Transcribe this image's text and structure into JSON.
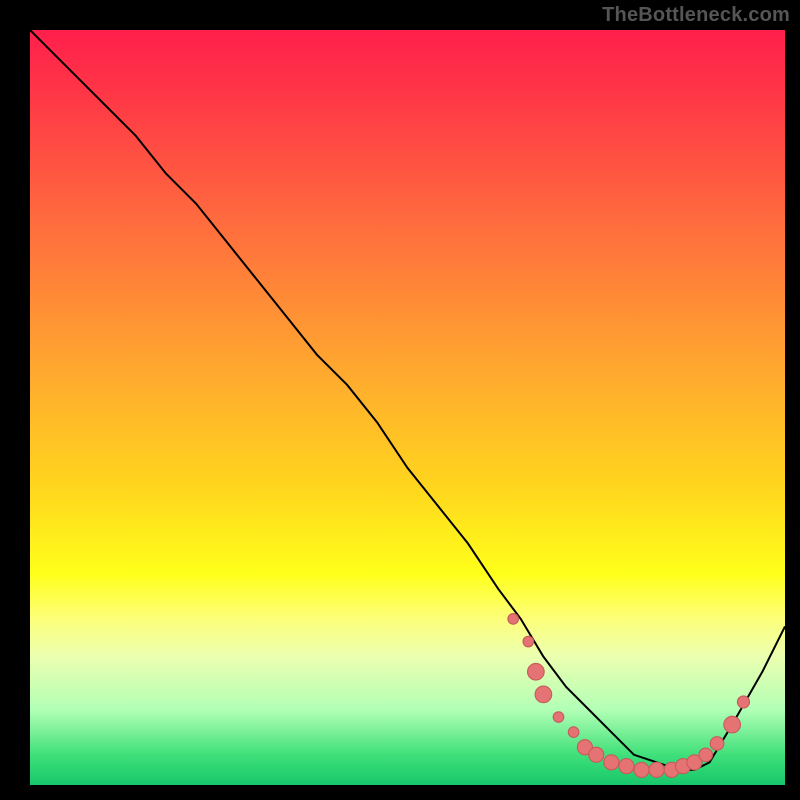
{
  "attribution": "TheBottleneck.com",
  "chart_data": {
    "type": "line",
    "title": "",
    "xlabel": "",
    "ylabel": "",
    "xlim": [
      0,
      100
    ],
    "ylim": [
      0,
      100
    ],
    "grid": false,
    "legend": false,
    "series": [
      {
        "name": "curve",
        "x": [
          0,
          3,
          6,
          10,
          14,
          18,
          22,
          26,
          30,
          34,
          38,
          42,
          46,
          50,
          54,
          58,
          62,
          65,
          68,
          71,
          74,
          77,
          80,
          83,
          86,
          88,
          90,
          93,
          97,
          100
        ],
        "values": [
          100,
          97,
          94,
          90,
          86,
          81,
          77,
          72,
          67,
          62,
          57,
          53,
          48,
          42,
          37,
          32,
          26,
          22,
          17,
          13,
          10,
          7,
          4,
          3,
          2,
          2,
          3,
          8,
          15,
          21
        ]
      }
    ],
    "markers": [
      {
        "x": 64,
        "y": 22,
        "r": 0.7
      },
      {
        "x": 66,
        "y": 19,
        "r": 0.7
      },
      {
        "x": 67,
        "y": 15,
        "r": 1.1
      },
      {
        "x": 68,
        "y": 12,
        "r": 1.1
      },
      {
        "x": 70,
        "y": 9,
        "r": 0.7
      },
      {
        "x": 72,
        "y": 7,
        "r": 0.7
      },
      {
        "x": 73.5,
        "y": 5,
        "r": 1.0
      },
      {
        "x": 75,
        "y": 4,
        "r": 1.0
      },
      {
        "x": 77,
        "y": 3,
        "r": 1.0
      },
      {
        "x": 79,
        "y": 2.5,
        "r": 1.0
      },
      {
        "x": 81,
        "y": 2,
        "r": 1.0
      },
      {
        "x": 83,
        "y": 2,
        "r": 1.0
      },
      {
        "x": 85,
        "y": 2,
        "r": 1.0
      },
      {
        "x": 86.5,
        "y": 2.5,
        "r": 1.0
      },
      {
        "x": 88,
        "y": 3,
        "r": 1.0
      },
      {
        "x": 89.5,
        "y": 4,
        "r": 0.9
      },
      {
        "x": 91,
        "y": 5.5,
        "r": 0.9
      },
      {
        "x": 93,
        "y": 8,
        "r": 1.1
      },
      {
        "x": 94.5,
        "y": 11,
        "r": 0.8
      }
    ],
    "colors": {
      "curve": "#000000",
      "marker_fill": "#e57373",
      "marker_stroke": "#c75b5b"
    }
  }
}
